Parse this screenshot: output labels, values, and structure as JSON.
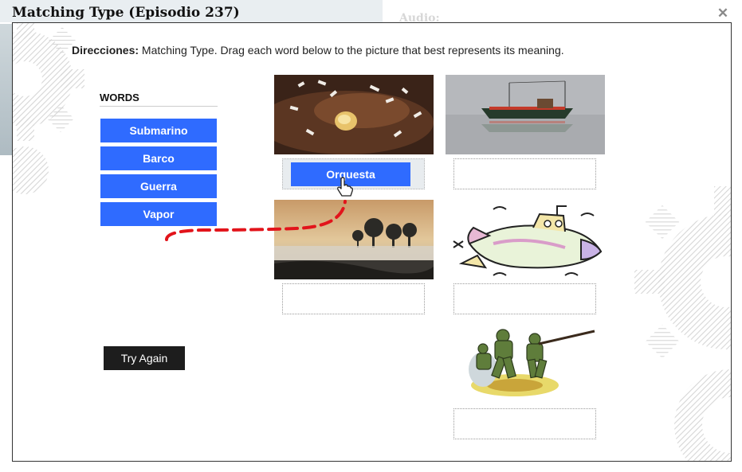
{
  "background": {
    "audio_label": "Audio:"
  },
  "modal": {
    "title": "Matching Type (Episodio 237)",
    "close_icon": "close-icon"
  },
  "directions": {
    "label": "Direcciones:",
    "text": " Matching Type. Drag each word below to the picture that best represents its meaning."
  },
  "words": {
    "header": "WORDS",
    "items": [
      "Submarino",
      "Barco",
      "Guerra",
      "Vapor"
    ]
  },
  "pictures": [
    {
      "name": "orchestra-picture",
      "dropped_word": "Orquesta"
    },
    {
      "name": "boat-picture",
      "dropped_word": ""
    },
    {
      "name": "foggy-lake-picture",
      "dropped_word": ""
    },
    {
      "name": "submarine-picture",
      "dropped_word": ""
    },
    {
      "name": "soldiers-picture",
      "dropped_word": ""
    }
  ],
  "buttons": {
    "try_again": "Try Again"
  },
  "colors": {
    "chip_blue": "#2f6bff",
    "button_dark": "#1d1d1d",
    "drag_path_red": "#e2141b"
  },
  "icons": {
    "cursor": "hand-pointer-icon"
  }
}
